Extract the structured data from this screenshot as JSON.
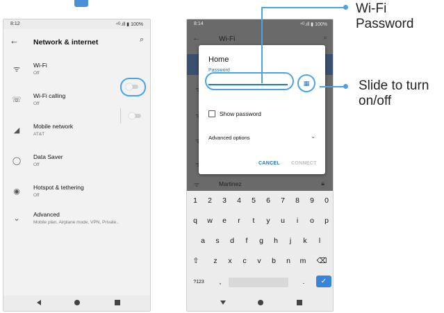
{
  "left_screen": {
    "status": {
      "time": "8:12",
      "right": "⁴ᴳ.ıll ▮ 100%"
    },
    "title": "Network & internet",
    "items": [
      {
        "label": "Wi-Fi",
        "sub": "Off"
      },
      {
        "label": "Wi-Fi calling",
        "sub": "Off"
      },
      {
        "label": "Mobile network",
        "sub": "AT&T"
      },
      {
        "label": "Data Saver",
        "sub": "Off"
      },
      {
        "label": "Hotspot & tethering",
        "sub": "Off"
      },
      {
        "label": "Advanced",
        "sub": "Mobile plan, Airplane mode, VPN, Private.."
      }
    ]
  },
  "right_screen": {
    "status": {
      "time": "8:14",
      "right": "⁴ᴳ.ıll ▮ 100%"
    },
    "title": "Wi-Fi",
    "dialog": {
      "title": "Home",
      "password_label": "Password",
      "password_value": "",
      "show_password": "Show password",
      "advanced": "Advanced options",
      "cancel": "CANCEL",
      "connect": "CONNECT"
    },
    "network_below": "Martinez",
    "keyboard": {
      "row1": [
        "1",
        "2",
        "3",
        "4",
        "5",
        "6",
        "7",
        "8",
        "9",
        "0"
      ],
      "row2": [
        "q",
        "w",
        "e",
        "r",
        "t",
        "y",
        "u",
        "i",
        "o",
        "p"
      ],
      "row3": [
        "a",
        "s",
        "d",
        "f",
        "g",
        "h",
        "j",
        "k",
        "l"
      ],
      "row4": [
        "z",
        "x",
        "c",
        "v",
        "b",
        "n",
        "m"
      ],
      "symbols": "?123",
      "comma": ",",
      "period": "."
    }
  },
  "callouts": {
    "password": "Wi-Fi\nPassword",
    "toggle": "Slide to turn\non/off"
  },
  "colors": {
    "accent": "#4aa3e8",
    "link": "#1a73c9",
    "band": "#3b4f6f"
  }
}
